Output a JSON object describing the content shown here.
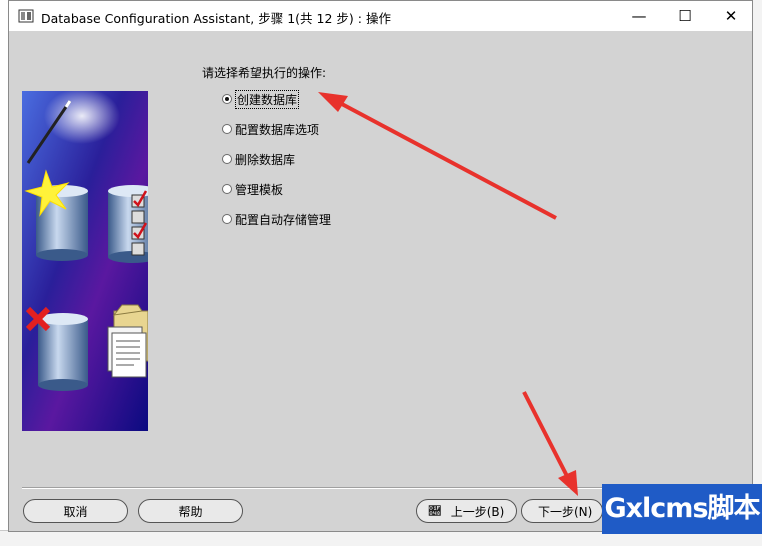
{
  "window": {
    "title": "Database Configuration Assistant, 步骤 1(共 12 步) : 操作",
    "controls": {
      "minimize": "—",
      "maximize": "☐",
      "close": "✕"
    }
  },
  "content": {
    "prompt": "请选择希望执行的操作:",
    "options": [
      {
        "label": "创建数据库",
        "selected": true
      },
      {
        "label": "配置数据库选项",
        "selected": false
      },
      {
        "label": "删除数据库",
        "selected": false
      },
      {
        "label": "管理模板",
        "selected": false
      },
      {
        "label": "配置自动存储管理",
        "selected": false
      }
    ]
  },
  "buttons": {
    "cancel": "取消",
    "help": "帮助",
    "back": "上一步(B)",
    "next": "下一步(N)"
  },
  "watermark": "Gxlcms脚本",
  "colors": {
    "dialog_bg": "#d3d3d3",
    "side_panel_blue": "#0a0a80",
    "annotation_red": "#e8322c",
    "watermark_bg": "#1f5bc6"
  }
}
